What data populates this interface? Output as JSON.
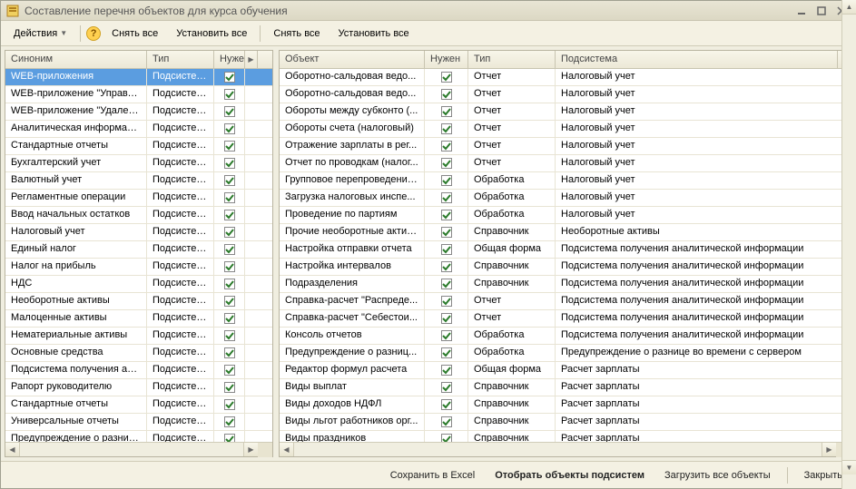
{
  "window": {
    "title": "Составление перечня объектов для курса обучения"
  },
  "toolbar": {
    "actions": "Действия",
    "uncheck_all_l": "Снять все",
    "check_all_l": "Установить все",
    "uncheck_all_r": "Снять все",
    "check_all_r": "Установить все"
  },
  "left": {
    "headers": {
      "synonym": "Синоним",
      "type": "Тип",
      "needed": "Нуже"
    },
    "rows": [
      {
        "syn": "WEB-приложения",
        "type": "Подсистема",
        "chk": true,
        "sel": true
      },
      {
        "syn": "WEB-приложение \"Управл...",
        "type": "Подсистема",
        "chk": true
      },
      {
        "syn": "WEB-приложение \"Удален...",
        "type": "Подсистема",
        "chk": true
      },
      {
        "syn": "Аналитическая информация",
        "type": "Подсистема",
        "chk": true
      },
      {
        "syn": "Стандартные отчеты",
        "type": "Подсистема",
        "chk": true
      },
      {
        "syn": "Бухгалтерский учет",
        "type": "Подсистема",
        "chk": true
      },
      {
        "syn": "Валютный учет",
        "type": "Подсистема",
        "chk": true
      },
      {
        "syn": "Регламентные операции",
        "type": "Подсистема",
        "chk": true
      },
      {
        "syn": "Ввод начальных остатков",
        "type": "Подсистема",
        "chk": true
      },
      {
        "syn": "Налоговый учет",
        "type": "Подсистема",
        "chk": true
      },
      {
        "syn": "Единый налог",
        "type": "Подсистема",
        "chk": true
      },
      {
        "syn": "Налог на прибыль",
        "type": "Подсистема",
        "chk": true
      },
      {
        "syn": "НДС",
        "type": "Подсистема",
        "chk": true
      },
      {
        "syn": "Необоротные активы",
        "type": "Подсистема",
        "chk": true
      },
      {
        "syn": "Малоценные активы",
        "type": "Подсистема",
        "chk": true
      },
      {
        "syn": "Нематериальные активы",
        "type": "Подсистема",
        "chk": true
      },
      {
        "syn": "Основные средства",
        "type": "Подсистема",
        "chk": true
      },
      {
        "syn": "Подсистема получения ана...",
        "type": "Подсистема",
        "chk": true
      },
      {
        "syn": "Рапорт руководителю",
        "type": "Подсистема",
        "chk": true
      },
      {
        "syn": "Стандартные отчеты",
        "type": "Подсистема",
        "chk": true
      },
      {
        "syn": "Универсальные отчеты",
        "type": "Подсистема",
        "chk": true
      },
      {
        "syn": "Предупреждение о разниц...",
        "type": "Подсистема",
        "chk": true
      }
    ]
  },
  "right": {
    "headers": {
      "object": "Объект",
      "needed": "Нужен",
      "type": "Тип",
      "subsystem": "Подсистема"
    },
    "rows": [
      {
        "obj": "Оборотно-сальдовая ведо...",
        "chk": true,
        "type": "Отчет",
        "sub": "Налоговый учет"
      },
      {
        "obj": "Оборотно-сальдовая ведо...",
        "chk": true,
        "type": "Отчет",
        "sub": "Налоговый учет"
      },
      {
        "obj": "Обороты между субконто (...",
        "chk": true,
        "type": "Отчет",
        "sub": "Налоговый учет"
      },
      {
        "obj": "Обороты счета (налоговый)",
        "chk": true,
        "type": "Отчет",
        "sub": "Налоговый учет"
      },
      {
        "obj": "Отражение зарплаты в рег...",
        "chk": true,
        "type": "Отчет",
        "sub": "Налоговый учет"
      },
      {
        "obj": "Отчет по проводкам (налог...",
        "chk": true,
        "type": "Отчет",
        "sub": "Налоговый учет"
      },
      {
        "obj": "Групповое перепроведение...",
        "chk": true,
        "type": "Обработка",
        "sub": "Налоговый учет"
      },
      {
        "obj": "Загрузка налоговых инспе...",
        "chk": true,
        "type": "Обработка",
        "sub": "Налоговый учет"
      },
      {
        "obj": "Проведение по партиям",
        "chk": true,
        "type": "Обработка",
        "sub": "Налоговый учет"
      },
      {
        "obj": "Прочие необоротные активы",
        "chk": true,
        "type": "Справочник",
        "sub": "Необоротные активы"
      },
      {
        "obj": "Настройка отправки отчета",
        "chk": true,
        "type": "Общая форма",
        "sub": "Подсистема получения аналитической информации"
      },
      {
        "obj": "Настройка интервалов",
        "chk": true,
        "type": "Справочник",
        "sub": "Подсистема получения аналитической информации"
      },
      {
        "obj": "Подразделения",
        "chk": true,
        "type": "Справочник",
        "sub": "Подсистема получения аналитической информации"
      },
      {
        "obj": "Справка-расчет \"Распреде...",
        "chk": true,
        "type": "Отчет",
        "sub": "Подсистема получения аналитической информации"
      },
      {
        "obj": "Справка-расчет \"Себестои...",
        "chk": true,
        "type": "Отчет",
        "sub": "Подсистема получения аналитической информации"
      },
      {
        "obj": "Консоль отчетов",
        "chk": true,
        "type": "Обработка",
        "sub": "Подсистема получения аналитической информации"
      },
      {
        "obj": "Предупреждение о разниц...",
        "chk": true,
        "type": "Обработка",
        "sub": "Предупреждение о разнице во времени с сервером"
      },
      {
        "obj": "Редактор формул расчета",
        "chk": true,
        "type": "Общая форма",
        "sub": "Расчет зарплаты"
      },
      {
        "obj": "Виды выплат",
        "chk": true,
        "type": "Справочник",
        "sub": "Расчет зарплаты"
      },
      {
        "obj": "Виды доходов НДФЛ",
        "chk": true,
        "type": "Справочник",
        "sub": "Расчет зарплаты"
      },
      {
        "obj": "Виды льгот работников орг...",
        "chk": true,
        "type": "Справочник",
        "sub": "Расчет зарплаты"
      },
      {
        "obj": "Виды праздников",
        "chk": true,
        "type": "Справочник",
        "sub": "Расчет зарплаты"
      }
    ]
  },
  "footer": {
    "save_excel": "Сохранить в Excel",
    "select_subsys": "Отобрать объекты подсистем",
    "load_all": "Загрузить все объекты",
    "close": "Закрыть"
  }
}
